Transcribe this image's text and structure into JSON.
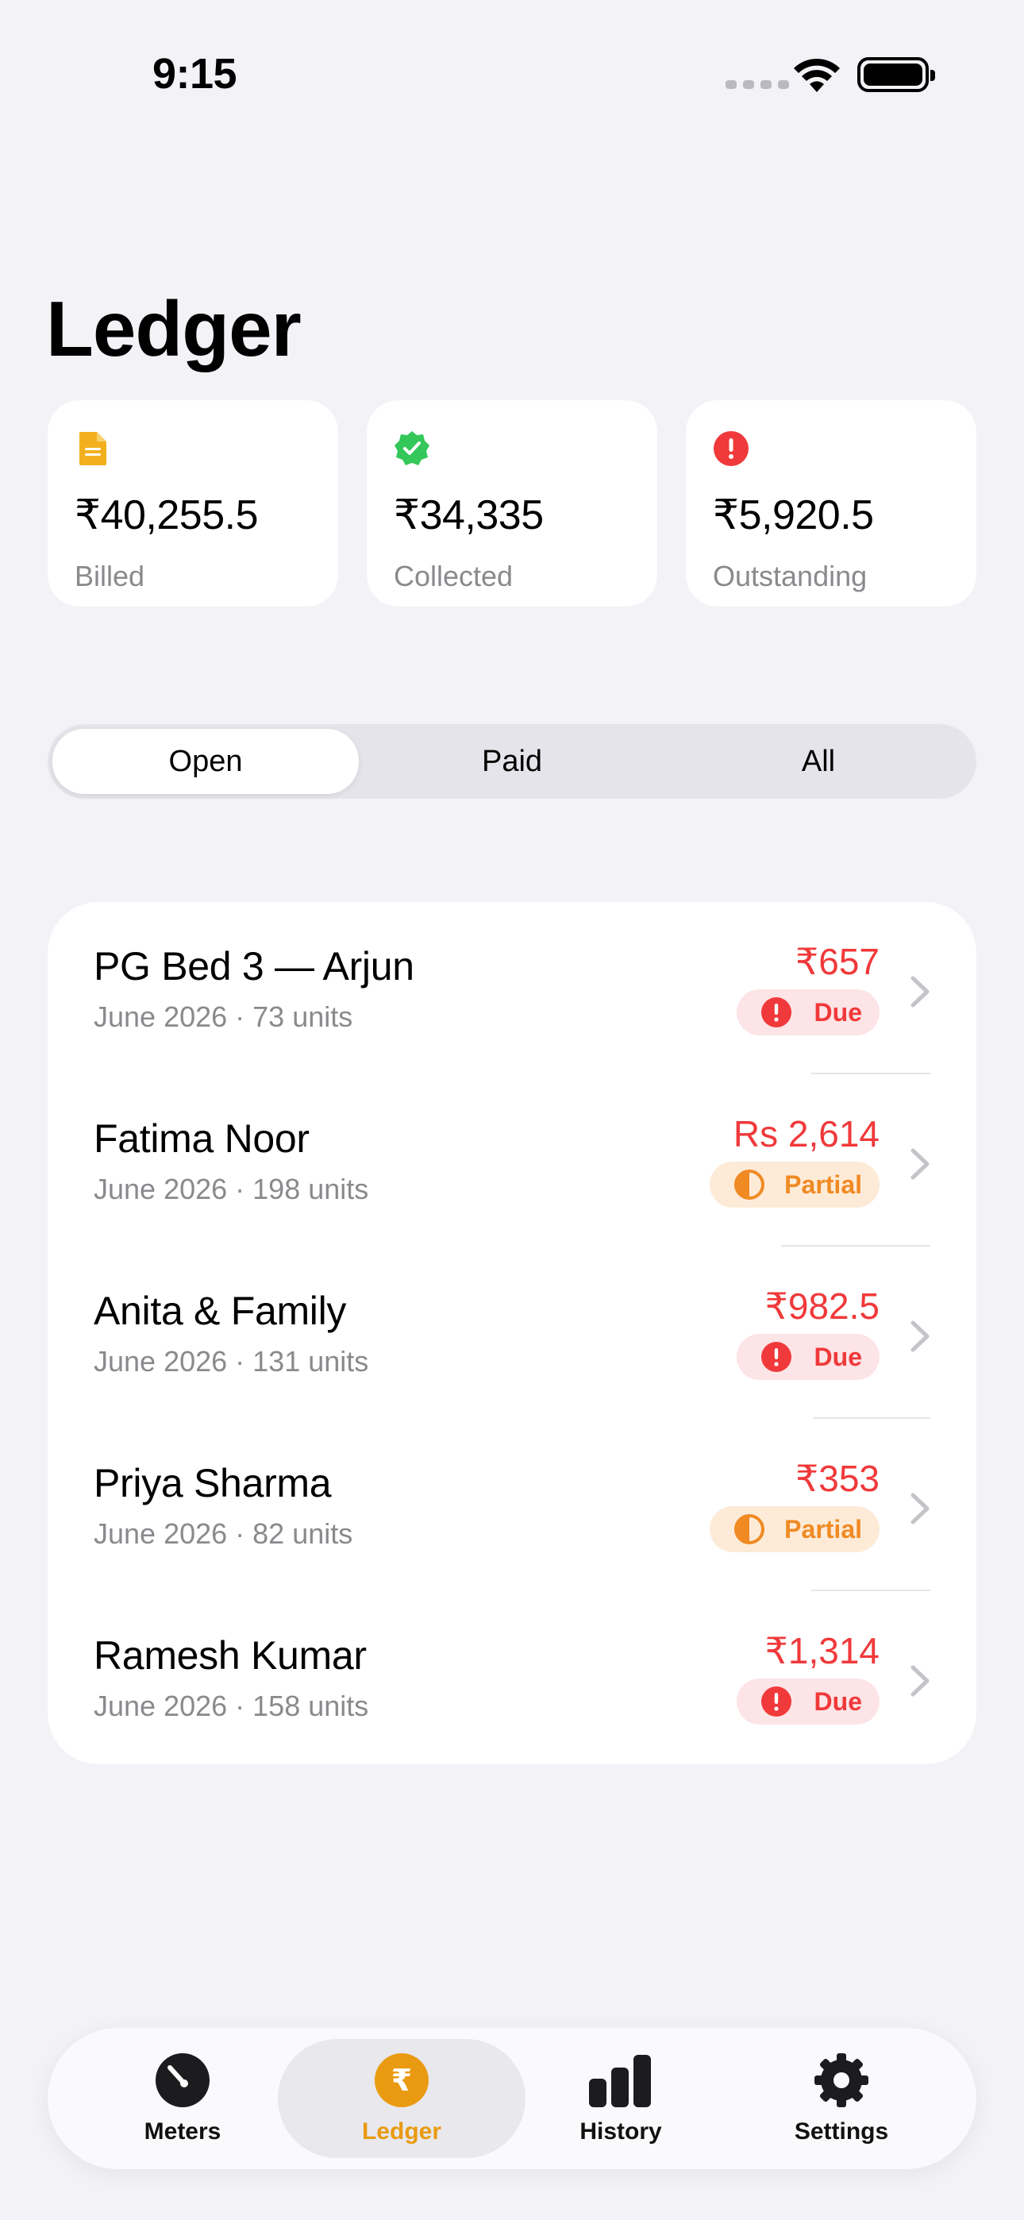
{
  "status_bar": {
    "time": "9:15"
  },
  "page": {
    "title": "Ledger"
  },
  "stats": [
    {
      "value": "₹40,255.5",
      "label": "Billed",
      "icon": "document-icon",
      "color": "#f2b01e"
    },
    {
      "value": "₹34,335",
      "label": "Collected",
      "icon": "checkmark-seal-icon",
      "color": "#34c759"
    },
    {
      "value": "₹5,920.5",
      "label": "Outstanding",
      "icon": "exclamation-circle-icon",
      "color": "#f0393a"
    }
  ],
  "segments": {
    "items": [
      "Open",
      "Paid",
      "All"
    ],
    "selected": "Open"
  },
  "bills": [
    {
      "name": "PG Bed 3 — Arjun",
      "subtitle": "June 2026 · 73 units",
      "amount": "₹657",
      "status": "Due"
    },
    {
      "name": "Fatima Noor",
      "subtitle": "June 2026 · 198 units",
      "amount": "Rs 2,614",
      "status": "Partial"
    },
    {
      "name": "Anita & Family",
      "subtitle": "June 2026 · 131 units",
      "amount": "₹982.5",
      "status": "Due"
    },
    {
      "name": "Priya Sharma",
      "subtitle": "June 2026 · 82 units",
      "amount": "₹353",
      "status": "Partial"
    },
    {
      "name": "Ramesh Kumar",
      "subtitle": "June 2026 · 158 units",
      "amount": "₹1,314",
      "status": "Due"
    }
  ],
  "tabbar": {
    "items": [
      {
        "label": "Meters",
        "icon": "gauge-icon"
      },
      {
        "label": "Ledger",
        "icon": "rupee-circle-icon"
      },
      {
        "label": "History",
        "icon": "bar-chart-icon"
      },
      {
        "label": "Settings",
        "icon": "gear-icon"
      }
    ],
    "active": "Ledger"
  },
  "colors": {
    "accent": "#e99a10",
    "due": "#f0393a",
    "partial": "#f08a23",
    "background": "#f2f2f7"
  }
}
